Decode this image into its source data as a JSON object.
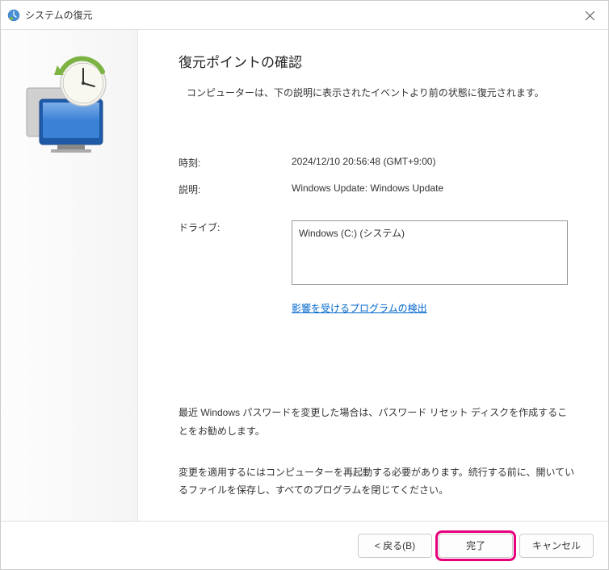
{
  "titlebar": {
    "title": "システムの復元"
  },
  "main": {
    "heading": "復元ポイントの確認",
    "intro": "コンピューターは、下の説明に表示されたイベントより前の状態に復元されます。",
    "time_label": "時刻:",
    "time_value": "2024/12/10 20:56:48 (GMT+9:00)",
    "description_label": "説明:",
    "description_value": "Windows Update: Windows Update",
    "drive_label": "ドライブ:",
    "drive_value": "Windows (C:) (システム)",
    "scan_link": "影響を受けるプログラムの検出",
    "note1": "最近 Windows パスワードを変更した場合は、パスワード リセット ディスクを作成することをお勧めします。",
    "note2": "変更を適用するにはコンピューターを再起動する必要があります。続行する前に、開いているファイルを保存し、すべてのプログラムを閉じてください。"
  },
  "footer": {
    "back": "< 戻る(B)",
    "finish": "完了",
    "cancel": "キャンセル"
  }
}
